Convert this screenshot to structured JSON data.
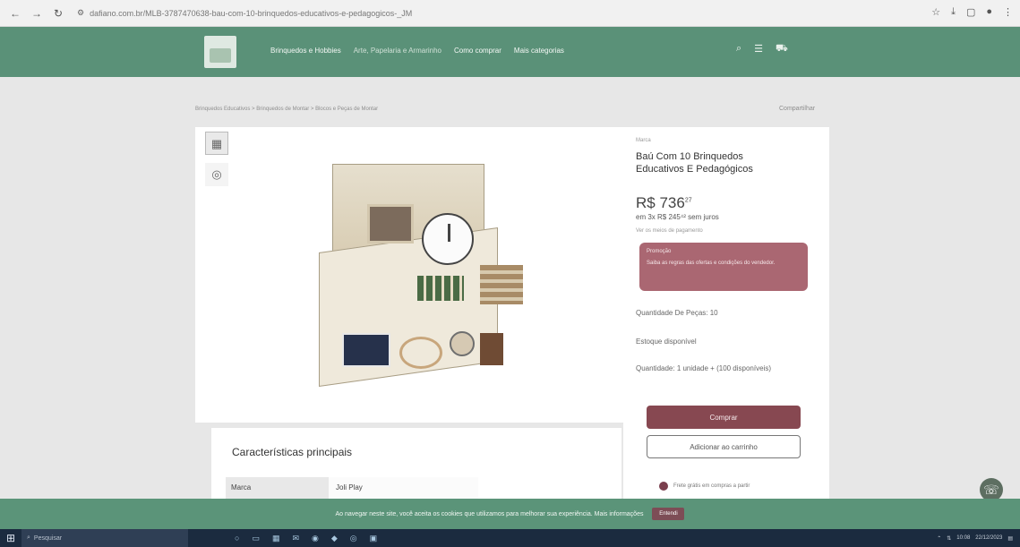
{
  "browser": {
    "url": "dafiano.com.br/MLB-3787470638-bau-com-10-brinquedos-educativos-e-pedagogicos-_JM",
    "back_icon": "arrow-left",
    "forward_icon": "arrow-right",
    "reload_icon": "reload",
    "site_info_icon": "site-info"
  },
  "header": {
    "menu": [
      "Brinquedos e Hobbies",
      "Arte, Papelaria e Armarinho",
      "Como comprar",
      "Mais categorias"
    ]
  },
  "breadcrumb": "Brinquedos Educativos > Brinquedos de Montar > Blocos e Peças de Montar",
  "breadcrumb_right": "Compartilhar",
  "product": {
    "brand": "Marca",
    "title": "Baú Com 10 Brinquedos Educativos E Pedagógicos",
    "price_main": "R$ 736",
    "price_cents": "27",
    "installments": "em 3x R$ 245⁴² sem juros",
    "payment_link": "Ver os meios de pagamento",
    "promo_heading": "Promoção",
    "promo_body": "Saiba as regras das ofertas e condições do vendedor.",
    "spec_pieces": "Quantidade De Peças: 10",
    "spec_stock": "Estoque disponível",
    "spec_qty": "Quantidade: 1 unidade + (100 disponíveis)"
  },
  "actions": {
    "buy_label": "Comprar",
    "cart_label": "Adicionar ao carrinho"
  },
  "shipping_text": "Frete grátis em compras a partir",
  "characteristics": {
    "title": "Características principais",
    "rows": [
      {
        "key": "Marca",
        "value": "Joli Play"
      }
    ]
  },
  "cookie": {
    "text": "Ao navegar neste site, você aceita os cookies que utilizamos para melhorar sua experiência. Mais informações",
    "accept_label": "Entendi"
  },
  "taskbar": {
    "search_placeholder": "Pesquisar",
    "time": "10:08",
    "date": "22/12/2023"
  },
  "colors": {
    "header_green": "#5a9178",
    "buy_button": "#874851",
    "promo_box": "#aa6772",
    "cookie_green": "#5b9479"
  }
}
